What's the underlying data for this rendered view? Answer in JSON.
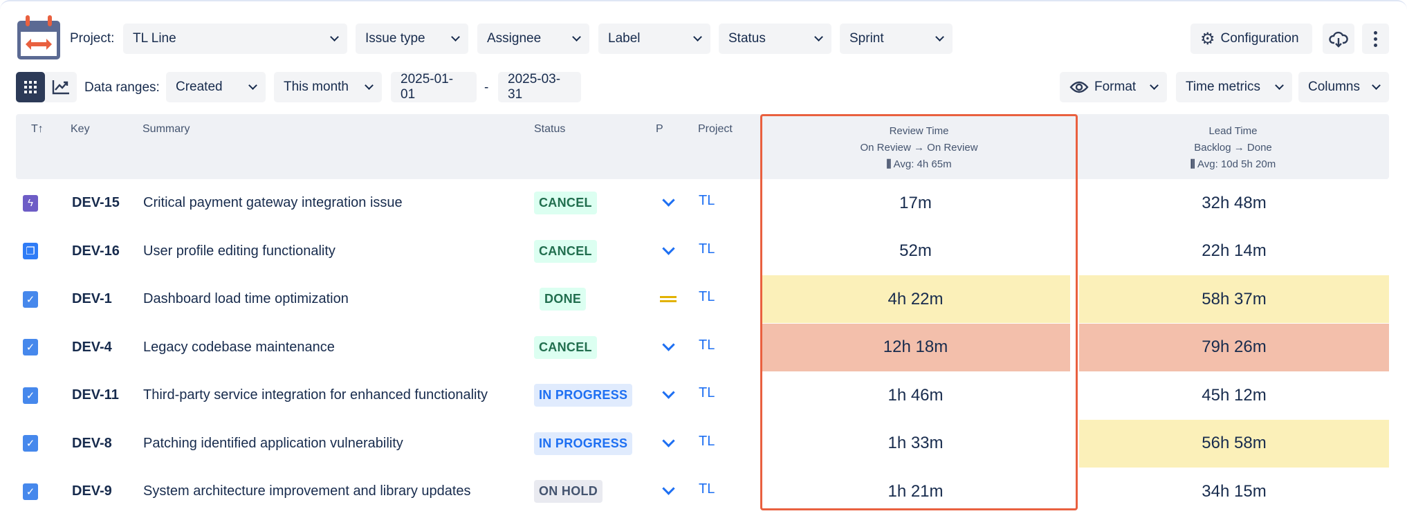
{
  "toolbar": {
    "project_label": "Project:",
    "project_value": "TL Line",
    "filters": [
      "Issue type",
      "Assignee",
      "Label",
      "Status",
      "Sprint"
    ],
    "configuration": "Configuration"
  },
  "ranges": {
    "label": "Data ranges:",
    "field": "Created",
    "period": "This month",
    "from": "2025-01-01",
    "sep": "-",
    "to": "2025-03-31",
    "format": "Format",
    "time_metrics": "Time metrics",
    "columns": "Columns"
  },
  "table": {
    "headers": {
      "type": "T↑",
      "key": "Key",
      "summary": "Summary",
      "status": "Status",
      "priority": "P",
      "project": "Project"
    },
    "review": {
      "title": "Review Time",
      "transition": "On Review → On Review",
      "avg": "Avg: 4h 65m"
    },
    "lead": {
      "title": "Lead Time",
      "transition": "Backlog → Done",
      "avg": "Avg: 10d 5h 20m"
    },
    "rows": [
      {
        "type": "epic",
        "key": "DEV-15",
        "summary": "Critical payment gateway integration issue",
        "status": "CANCEL",
        "priority": "low",
        "project": "TL",
        "review": "17m",
        "lead": "32h 48m",
        "review_hl": "",
        "lead_hl": ""
      },
      {
        "type": "story",
        "key": "DEV-16",
        "summary": "User profile editing functionality",
        "status": "CANCEL",
        "priority": "low",
        "project": "TL",
        "review": "52m",
        "lead": "22h 14m",
        "review_hl": "",
        "lead_hl": ""
      },
      {
        "type": "task",
        "key": "DEV-1",
        "summary": "Dashboard load time optimization",
        "status": "DONE",
        "priority": "medium",
        "project": "TL",
        "review": "4h 22m",
        "lead": "58h 37m",
        "review_hl": "#fbf0b9",
        "lead_hl": "#fbf0b9"
      },
      {
        "type": "task",
        "key": "DEV-4",
        "summary": "Legacy codebase maintenance",
        "status": "CANCEL",
        "priority": "low",
        "project": "TL",
        "review": "12h 18m",
        "lead": "79h 26m",
        "review_hl": "#f3bfab",
        "lead_hl": "#f3bfab"
      },
      {
        "type": "task",
        "key": "DEV-11",
        "summary": "Third-party service integration for enhanced functionality",
        "status": "IN PROGRESS",
        "priority": "low",
        "project": "TL",
        "review": "1h 46m",
        "lead": "45h 12m",
        "review_hl": "",
        "lead_hl": ""
      },
      {
        "type": "task",
        "key": "DEV-8",
        "summary": "Patching identified application vulnerability",
        "status": "IN PROGRESS",
        "priority": "low",
        "project": "TL",
        "review": "1h 33m",
        "lead": "56h 58m",
        "review_hl": "",
        "lead_hl": "#fbf0b9"
      },
      {
        "type": "task",
        "key": "DEV-9",
        "summary": "System architecture improvement and library updates",
        "status": "ON HOLD",
        "priority": "low",
        "project": "TL",
        "review": "1h 21m",
        "lead": "34h 15m",
        "review_hl": "",
        "lead_hl": ""
      }
    ]
  },
  "colors": {
    "accent": "#e9603f",
    "link": "#1d6ff2",
    "dark": "#2c3a57"
  }
}
